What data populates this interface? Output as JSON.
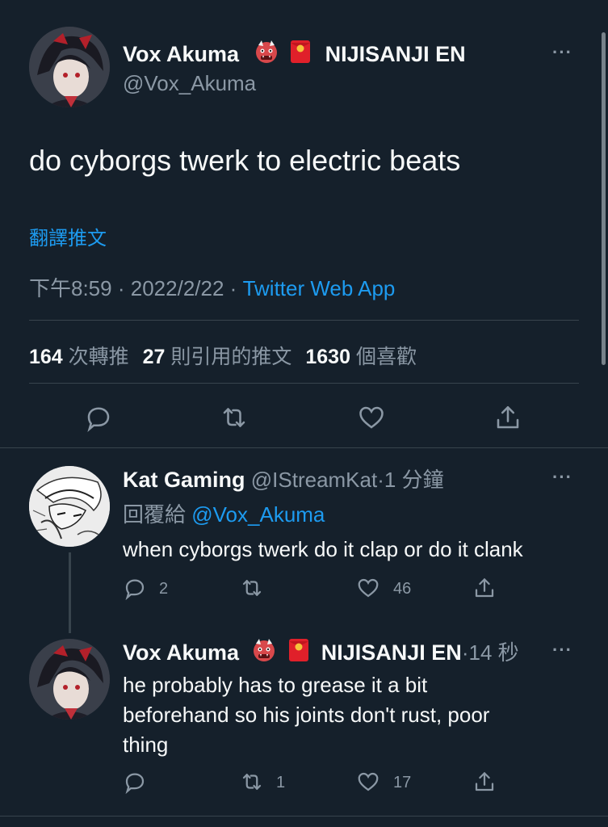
{
  "main_tweet": {
    "display_name": "Vox Akuma",
    "emojis": [
      "ogre-emoji",
      "red-envelope-emoji"
    ],
    "affiliation": "NIJISANJI EN",
    "handle": "@Vox_Akuma",
    "text": "do cyborgs twerk to electric beats",
    "translate_label": "翻譯推文",
    "time": "下午8:59",
    "date": "2022/2/22",
    "separator": "·",
    "source": "Twitter Web App",
    "retweet_count": "164",
    "retweet_label": "次轉推",
    "quote_count": "27",
    "quote_label": "則引用的推文",
    "like_count": "1630",
    "like_label": "個喜歡",
    "more_label": "···"
  },
  "replies": [
    {
      "display_name": "Kat Gaming",
      "handle": "@IStreamKat",
      "separator": "·",
      "time_ago": "1 分鐘",
      "reply_to_label": "回覆給",
      "reply_to_handle": "@Vox_Akuma",
      "text": "when cyborgs twerk do it clap or do it clank",
      "reply_count": "2",
      "retweet_count": "",
      "like_count": "46",
      "more_label": "···"
    },
    {
      "display_name": "Vox Akuma",
      "affiliation": "NIJISANJI EN",
      "separator": "·",
      "time_ago": "14 秒",
      "text_line1": "he probably has to grease it a bit",
      "text_line2": "beforehand so his joints don't rust, poor",
      "text_line3": "thing",
      "reply_count": "",
      "retweet_count": "1",
      "like_count": "17",
      "more_label": "···"
    }
  ],
  "colors": {
    "background": "#15202b",
    "text": "#f7f9f9",
    "muted": "#8b98a5",
    "link": "#1d9bf0",
    "divider": "#38444d"
  }
}
